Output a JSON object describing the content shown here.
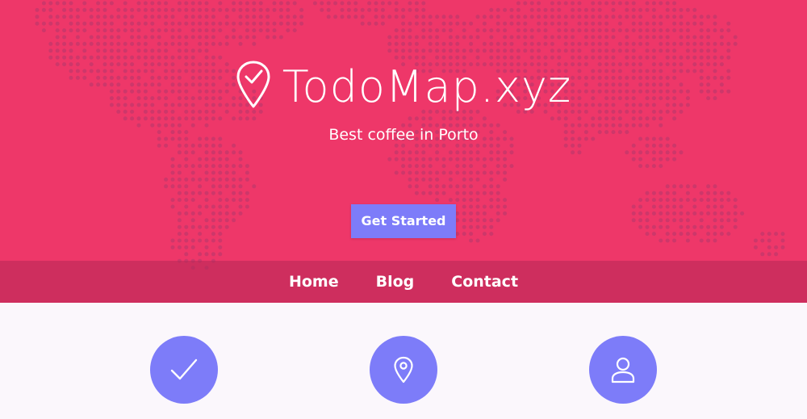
{
  "hero": {
    "brand_name": "TodoMap.xyz",
    "brand_icon": "map-pin-check-icon",
    "tagline": "Best coffee in Porto",
    "cta_label": "Get Started",
    "background_map": "world-dot-map"
  },
  "nav": {
    "items": [
      {
        "label": "Home"
      },
      {
        "label": "Blog"
      },
      {
        "label": "Contact"
      }
    ]
  },
  "features": {
    "icons": [
      "checkmark-icon",
      "map-pin-icon",
      "user-icon"
    ]
  },
  "colors": {
    "hero_bg": "#ee3769",
    "dot": "#c2386b",
    "accent": "#7d7cf9",
    "nav_bg": "#c23560",
    "features_bg": "#fbf7fc"
  }
}
